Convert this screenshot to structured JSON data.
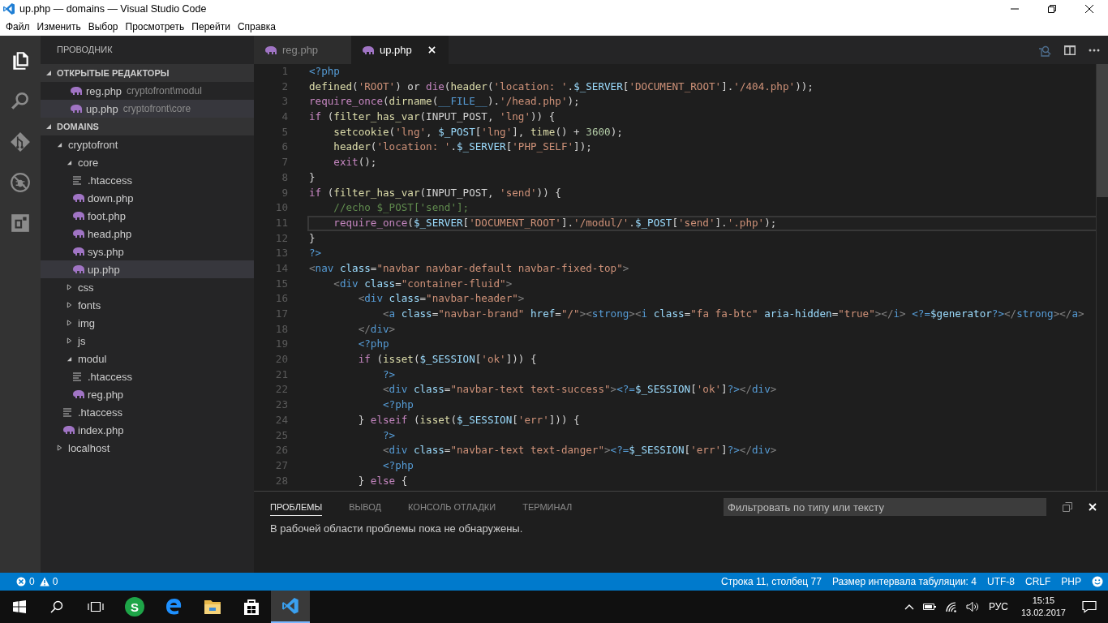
{
  "window": {
    "title": "up.php — domains — Visual Studio Code"
  },
  "menu": [
    "Файл",
    "Изменить",
    "Выбор",
    "Просмотреть",
    "Перейти",
    "Справка"
  ],
  "activity_bar": [
    {
      "kind": "files",
      "selected": true
    },
    {
      "kind": "search",
      "selected": false
    },
    {
      "kind": "git",
      "selected": false
    },
    {
      "kind": "debug",
      "selected": false
    },
    {
      "kind": "extensions",
      "selected": false
    }
  ],
  "sidebar": {
    "title": "ПРОВОДНИК",
    "open_editors": {
      "title": "ОТКРЫТЫЕ РЕДАКТОРЫ",
      "expanded": true,
      "items": [
        {
          "name": "reg.php",
          "path": "cryptofront\\modul",
          "selected": false
        },
        {
          "name": "up.php",
          "path": "cryptofront\\core",
          "selected": true
        }
      ]
    },
    "folder": {
      "title": "DOMAINS",
      "expanded": true
    },
    "tree": [
      {
        "name": "cryptofront",
        "kind": "folder",
        "expanded": true,
        "selected": false,
        "children": [
          {
            "name": "core",
            "kind": "folder",
            "expanded": true,
            "selected": false,
            "children": [
              {
                "name": ".htaccess",
                "kind": "text",
                "selected": false
              },
              {
                "name": "down.php",
                "kind": "php",
                "selected": false
              },
              {
                "name": "foot.php",
                "kind": "php",
                "selected": false
              },
              {
                "name": "head.php",
                "kind": "php",
                "selected": false
              },
              {
                "name": "sys.php",
                "kind": "php",
                "selected": false
              },
              {
                "name": "up.php",
                "kind": "php",
                "selected": true
              }
            ]
          },
          {
            "name": "css",
            "kind": "folder",
            "expanded": false,
            "selected": false
          },
          {
            "name": "fonts",
            "kind": "folder",
            "expanded": false,
            "selected": false
          },
          {
            "name": "img",
            "kind": "folder",
            "expanded": false,
            "selected": false
          },
          {
            "name": "js",
            "kind": "folder",
            "expanded": false,
            "selected": false
          },
          {
            "name": "modul",
            "kind": "folder",
            "expanded": true,
            "selected": false,
            "children": [
              {
                "name": ".htaccess",
                "kind": "text",
                "selected": false
              },
              {
                "name": "reg.php",
                "kind": "php",
                "selected": false
              }
            ]
          },
          {
            "name": ".htaccess",
            "kind": "text",
            "selected": false
          },
          {
            "name": "index.php",
            "kind": "php",
            "selected": false
          }
        ]
      },
      {
        "name": "localhost",
        "kind": "folder",
        "expanded": false,
        "selected": false
      }
    ]
  },
  "tabs": [
    {
      "label": "reg.php",
      "selected": false
    },
    {
      "label": "up.php",
      "selected": true
    }
  ],
  "editor": {
    "lines": [
      {
        "number": "1",
        "current": false,
        "tokens": [
          {
            "kind": "php",
            "text": "<?php"
          }
        ]
      },
      {
        "number": "2",
        "current": false,
        "tokens": [
          {
            "kind": "fn",
            "text": "defined"
          },
          {
            "kind": "p",
            "text": "("
          },
          {
            "kind": "s",
            "text": "'ROOT'"
          },
          {
            "kind": "p",
            "text": ") or "
          },
          {
            "kind": "kw",
            "text": "die"
          },
          {
            "kind": "p",
            "text": "("
          },
          {
            "kind": "fn",
            "text": "header"
          },
          {
            "kind": "p",
            "text": "("
          },
          {
            "kind": "s",
            "text": "'location: '"
          },
          {
            "kind": "p",
            "text": "."
          },
          {
            "kind": "v",
            "text": "$_SERVER"
          },
          {
            "kind": "p",
            "text": "["
          },
          {
            "kind": "s",
            "text": "'DOCUMENT_ROOT'"
          },
          {
            "kind": "p",
            "text": "]."
          },
          {
            "kind": "s",
            "text": "'/404.php'"
          },
          {
            "kind": "p",
            "text": "));"
          }
        ]
      },
      {
        "number": "3",
        "current": false,
        "tokens": [
          {
            "kind": "kw",
            "text": "require_once"
          },
          {
            "kind": "p",
            "text": "("
          },
          {
            "kind": "fn",
            "text": "dirname"
          },
          {
            "kind": "p",
            "text": "("
          },
          {
            "kind": "c",
            "text": "__FILE__"
          },
          {
            "kind": "p",
            "text": ")."
          },
          {
            "kind": "s",
            "text": "'/head.php'"
          },
          {
            "kind": "p",
            "text": ");"
          }
        ]
      },
      {
        "number": "4",
        "current": false,
        "tokens": [
          {
            "kind": "kw",
            "text": "if"
          },
          {
            "kind": "p",
            "text": " ("
          },
          {
            "kind": "fn",
            "text": "filter_has_var"
          },
          {
            "kind": "p",
            "text": "(INPUT_POST, "
          },
          {
            "kind": "s",
            "text": "'lng'"
          },
          {
            "kind": "p",
            "text": ")) {"
          }
        ]
      },
      {
        "number": "5",
        "current": false,
        "tokens": [
          {
            "kind": "fn",
            "text": "    setcookie"
          },
          {
            "kind": "p",
            "text": "("
          },
          {
            "kind": "s",
            "text": "'lng'"
          },
          {
            "kind": "p",
            "text": ", "
          },
          {
            "kind": "v",
            "text": "$_POST"
          },
          {
            "kind": "p",
            "text": "["
          },
          {
            "kind": "s",
            "text": "'lng'"
          },
          {
            "kind": "p",
            "text": "], "
          },
          {
            "kind": "fn",
            "text": "time"
          },
          {
            "kind": "p",
            "text": "() + "
          },
          {
            "kind": "n",
            "text": "3600"
          },
          {
            "kind": "p",
            "text": ");"
          }
        ]
      },
      {
        "number": "6",
        "current": false,
        "tokens": [
          {
            "kind": "fn",
            "text": "    header"
          },
          {
            "kind": "p",
            "text": "("
          },
          {
            "kind": "s",
            "text": "'location: '"
          },
          {
            "kind": "p",
            "text": "."
          },
          {
            "kind": "v",
            "text": "$_SERVER"
          },
          {
            "kind": "p",
            "text": "["
          },
          {
            "kind": "s",
            "text": "'PHP_SELF'"
          },
          {
            "kind": "p",
            "text": "]);"
          }
        ]
      },
      {
        "number": "7",
        "current": false,
        "tokens": [
          {
            "kind": "kw",
            "text": "    exit"
          },
          {
            "kind": "p",
            "text": "();"
          }
        ]
      },
      {
        "number": "8",
        "current": false,
        "tokens": [
          {
            "kind": "p",
            "text": "}"
          }
        ]
      },
      {
        "number": "9",
        "current": false,
        "tokens": [
          {
            "kind": "kw",
            "text": "if"
          },
          {
            "kind": "p",
            "text": " ("
          },
          {
            "kind": "fn",
            "text": "filter_has_var"
          },
          {
            "kind": "p",
            "text": "(INPUT_POST, "
          },
          {
            "kind": "s",
            "text": "'send'"
          },
          {
            "kind": "p",
            "text": ")) {"
          }
        ]
      },
      {
        "number": "10",
        "current": false,
        "tokens": [
          {
            "kind": "cm",
            "text": "    //echo $_POST['send'];"
          }
        ]
      },
      {
        "number": "11",
        "current": true,
        "tokens": [
          {
            "kind": "kw",
            "text": "    require_once"
          },
          {
            "kind": "p",
            "text": "("
          },
          {
            "kind": "v",
            "text": "$_SERVER"
          },
          {
            "kind": "p",
            "text": "["
          },
          {
            "kind": "s",
            "text": "'DOCUMENT_ROOT'"
          },
          {
            "kind": "p",
            "text": "]."
          },
          {
            "kind": "s",
            "text": "'/modul/'"
          },
          {
            "kind": "p",
            "text": "."
          },
          {
            "kind": "v",
            "text": "$_POST"
          },
          {
            "kind": "p",
            "text": "["
          },
          {
            "kind": "s",
            "text": "'send'"
          },
          {
            "kind": "p",
            "text": "]."
          },
          {
            "kind": "s",
            "text": "'.php'"
          },
          {
            "kind": "p",
            "text": ");"
          }
        ]
      },
      {
        "number": "12",
        "current": false,
        "tokens": [
          {
            "kind": "p",
            "text": "}"
          }
        ]
      },
      {
        "number": "13",
        "current": false,
        "tokens": [
          {
            "kind": "php",
            "text": "?>"
          }
        ]
      },
      {
        "number": "14",
        "current": false,
        "tokens": [
          {
            "kind": "tp",
            "text": "<"
          },
          {
            "kind": "tg",
            "text": "nav"
          },
          {
            "kind": "at",
            "text": " class"
          },
          {
            "kind": "p",
            "text": "="
          },
          {
            "kind": "s",
            "text": "\"navbar navbar-default navbar-fixed-top\""
          },
          {
            "kind": "tp",
            "text": ">"
          }
        ]
      },
      {
        "number": "15",
        "current": false,
        "tokens": [
          {
            "kind": "tp",
            "text": "    <"
          },
          {
            "kind": "tg",
            "text": "div"
          },
          {
            "kind": "at",
            "text": " class"
          },
          {
            "kind": "p",
            "text": "="
          },
          {
            "kind": "s",
            "text": "\"container-fluid\""
          },
          {
            "kind": "tp",
            "text": ">"
          }
        ]
      },
      {
        "number": "16",
        "current": false,
        "tokens": [
          {
            "kind": "tp",
            "text": "        <"
          },
          {
            "kind": "tg",
            "text": "div"
          },
          {
            "kind": "at",
            "text": " class"
          },
          {
            "kind": "p",
            "text": "="
          },
          {
            "kind": "s",
            "text": "\"navbar-header\""
          },
          {
            "kind": "tp",
            "text": ">"
          }
        ]
      },
      {
        "number": "17",
        "current": false,
        "tokens": [
          {
            "kind": "tp",
            "text": "            <"
          },
          {
            "kind": "tg",
            "text": "a"
          },
          {
            "kind": "at",
            "text": " class"
          },
          {
            "kind": "p",
            "text": "="
          },
          {
            "kind": "s",
            "text": "\"navbar-brand\""
          },
          {
            "kind": "at",
            "text": " href"
          },
          {
            "kind": "p",
            "text": "="
          },
          {
            "kind": "s",
            "text": "\"/\""
          },
          {
            "kind": "tp",
            "text": "><"
          },
          {
            "kind": "tg",
            "text": "strong"
          },
          {
            "kind": "tp",
            "text": "><"
          },
          {
            "kind": "tg",
            "text": "i"
          },
          {
            "kind": "at",
            "text": " class"
          },
          {
            "kind": "p",
            "text": "="
          },
          {
            "kind": "s",
            "text": "\"fa fa-btc\""
          },
          {
            "kind": "at",
            "text": " aria-hidden"
          },
          {
            "kind": "p",
            "text": "="
          },
          {
            "kind": "s",
            "text": "\"true\""
          },
          {
            "kind": "tp",
            "text": "></"
          },
          {
            "kind": "tg",
            "text": "i"
          },
          {
            "kind": "tp",
            "text": "> "
          },
          {
            "kind": "php",
            "text": "<?="
          },
          {
            "kind": "v",
            "text": "$generator"
          },
          {
            "kind": "php",
            "text": "?>"
          },
          {
            "kind": "tp",
            "text": "</"
          },
          {
            "kind": "tg",
            "text": "strong"
          },
          {
            "kind": "tp",
            "text": "></"
          },
          {
            "kind": "tg",
            "text": "a"
          },
          {
            "kind": "tp",
            "text": ">"
          }
        ]
      },
      {
        "number": "18",
        "current": false,
        "tokens": [
          {
            "kind": "tp",
            "text": "        </"
          },
          {
            "kind": "tg",
            "text": "div"
          },
          {
            "kind": "tp",
            "text": ">"
          }
        ]
      },
      {
        "number": "19",
        "current": false,
        "tokens": [
          {
            "kind": "php",
            "text": "        <?php"
          }
        ]
      },
      {
        "number": "20",
        "current": false,
        "tokens": [
          {
            "kind": "kw",
            "text": "        if"
          },
          {
            "kind": "p",
            "text": " ("
          },
          {
            "kind": "fn",
            "text": "isset"
          },
          {
            "kind": "p",
            "text": "("
          },
          {
            "kind": "v",
            "text": "$_SESSION"
          },
          {
            "kind": "p",
            "text": "["
          },
          {
            "kind": "s",
            "text": "'ok'"
          },
          {
            "kind": "p",
            "text": "])) {"
          }
        ]
      },
      {
        "number": "21",
        "current": false,
        "tokens": [
          {
            "kind": "php",
            "text": "            ?>"
          }
        ]
      },
      {
        "number": "22",
        "current": false,
        "tokens": [
          {
            "kind": "tp",
            "text": "            <"
          },
          {
            "kind": "tg",
            "text": "div"
          },
          {
            "kind": "at",
            "text": " class"
          },
          {
            "kind": "p",
            "text": "="
          },
          {
            "kind": "s",
            "text": "\"navbar-text text-success\""
          },
          {
            "kind": "tp",
            "text": ">"
          },
          {
            "kind": "php",
            "text": "<?="
          },
          {
            "kind": "v",
            "text": "$_SESSION"
          },
          {
            "kind": "p",
            "text": "["
          },
          {
            "kind": "s",
            "text": "'ok'"
          },
          {
            "kind": "p",
            "text": "]"
          },
          {
            "kind": "php",
            "text": "?>"
          },
          {
            "kind": "tp",
            "text": "</"
          },
          {
            "kind": "tg",
            "text": "div"
          },
          {
            "kind": "tp",
            "text": ">"
          }
        ]
      },
      {
        "number": "23",
        "current": false,
        "tokens": [
          {
            "kind": "php",
            "text": "            <?php"
          }
        ]
      },
      {
        "number": "24",
        "current": false,
        "tokens": [
          {
            "kind": "p",
            "text": "        } "
          },
          {
            "kind": "kw",
            "text": "elseif"
          },
          {
            "kind": "p",
            "text": " ("
          },
          {
            "kind": "fn",
            "text": "isset"
          },
          {
            "kind": "p",
            "text": "("
          },
          {
            "kind": "v",
            "text": "$_SESSION"
          },
          {
            "kind": "p",
            "text": "["
          },
          {
            "kind": "s",
            "text": "'err'"
          },
          {
            "kind": "p",
            "text": "])) {"
          }
        ]
      },
      {
        "number": "25",
        "current": false,
        "tokens": [
          {
            "kind": "php",
            "text": "            ?>"
          }
        ]
      },
      {
        "number": "26",
        "current": false,
        "tokens": [
          {
            "kind": "tp",
            "text": "            <"
          },
          {
            "kind": "tg",
            "text": "div"
          },
          {
            "kind": "at",
            "text": " class"
          },
          {
            "kind": "p",
            "text": "="
          },
          {
            "kind": "s",
            "text": "\"navbar-text text-danger\""
          },
          {
            "kind": "tp",
            "text": ">"
          },
          {
            "kind": "php",
            "text": "<?="
          },
          {
            "kind": "v",
            "text": "$_SESSION"
          },
          {
            "kind": "p",
            "text": "["
          },
          {
            "kind": "s",
            "text": "'err'"
          },
          {
            "kind": "p",
            "text": "]"
          },
          {
            "kind": "php",
            "text": "?>"
          },
          {
            "kind": "tp",
            "text": "</"
          },
          {
            "kind": "tg",
            "text": "div"
          },
          {
            "kind": "tp",
            "text": ">"
          }
        ]
      },
      {
        "number": "27",
        "current": false,
        "tokens": [
          {
            "kind": "php",
            "text": "            <?php"
          }
        ]
      },
      {
        "number": "28",
        "current": false,
        "tokens": [
          {
            "kind": "p",
            "text": "        } "
          },
          {
            "kind": "kw",
            "text": "else"
          },
          {
            "kind": "p",
            "text": " {"
          }
        ]
      }
    ]
  },
  "panel": {
    "tabs": [
      {
        "label": "ПРОБЛЕМЫ",
        "selected": true
      },
      {
        "label": "ВЫВОД",
        "selected": false
      },
      {
        "label": "КОНСОЛЬ ОТЛАДКИ",
        "selected": false
      },
      {
        "label": "ТЕРМИНАЛ",
        "selected": false
      }
    ],
    "filter": {
      "placeholder": "Фильтровать по типу или тексту"
    },
    "message": "В рабочей области проблемы пока не обнаружены."
  },
  "status_bar": {
    "errors": "0",
    "warnings": "0",
    "items": [
      "Строка 11, столбец 77",
      "Размер интервала табуляции: 4",
      "UTF-8",
      "CRLF",
      "PHP"
    ]
  },
  "taskbar": {
    "apps": [
      {
        "kind": "letter",
        "label": "S",
        "selected": false
      },
      {
        "kind": "browser",
        "selected": false
      },
      {
        "kind": "folder",
        "selected": false
      },
      {
        "kind": "store",
        "selected": false
      },
      {
        "kind": "vscode",
        "selected": true
      }
    ],
    "language": "РУС",
    "time": "15:15",
    "date": "13.02.2017"
  }
}
